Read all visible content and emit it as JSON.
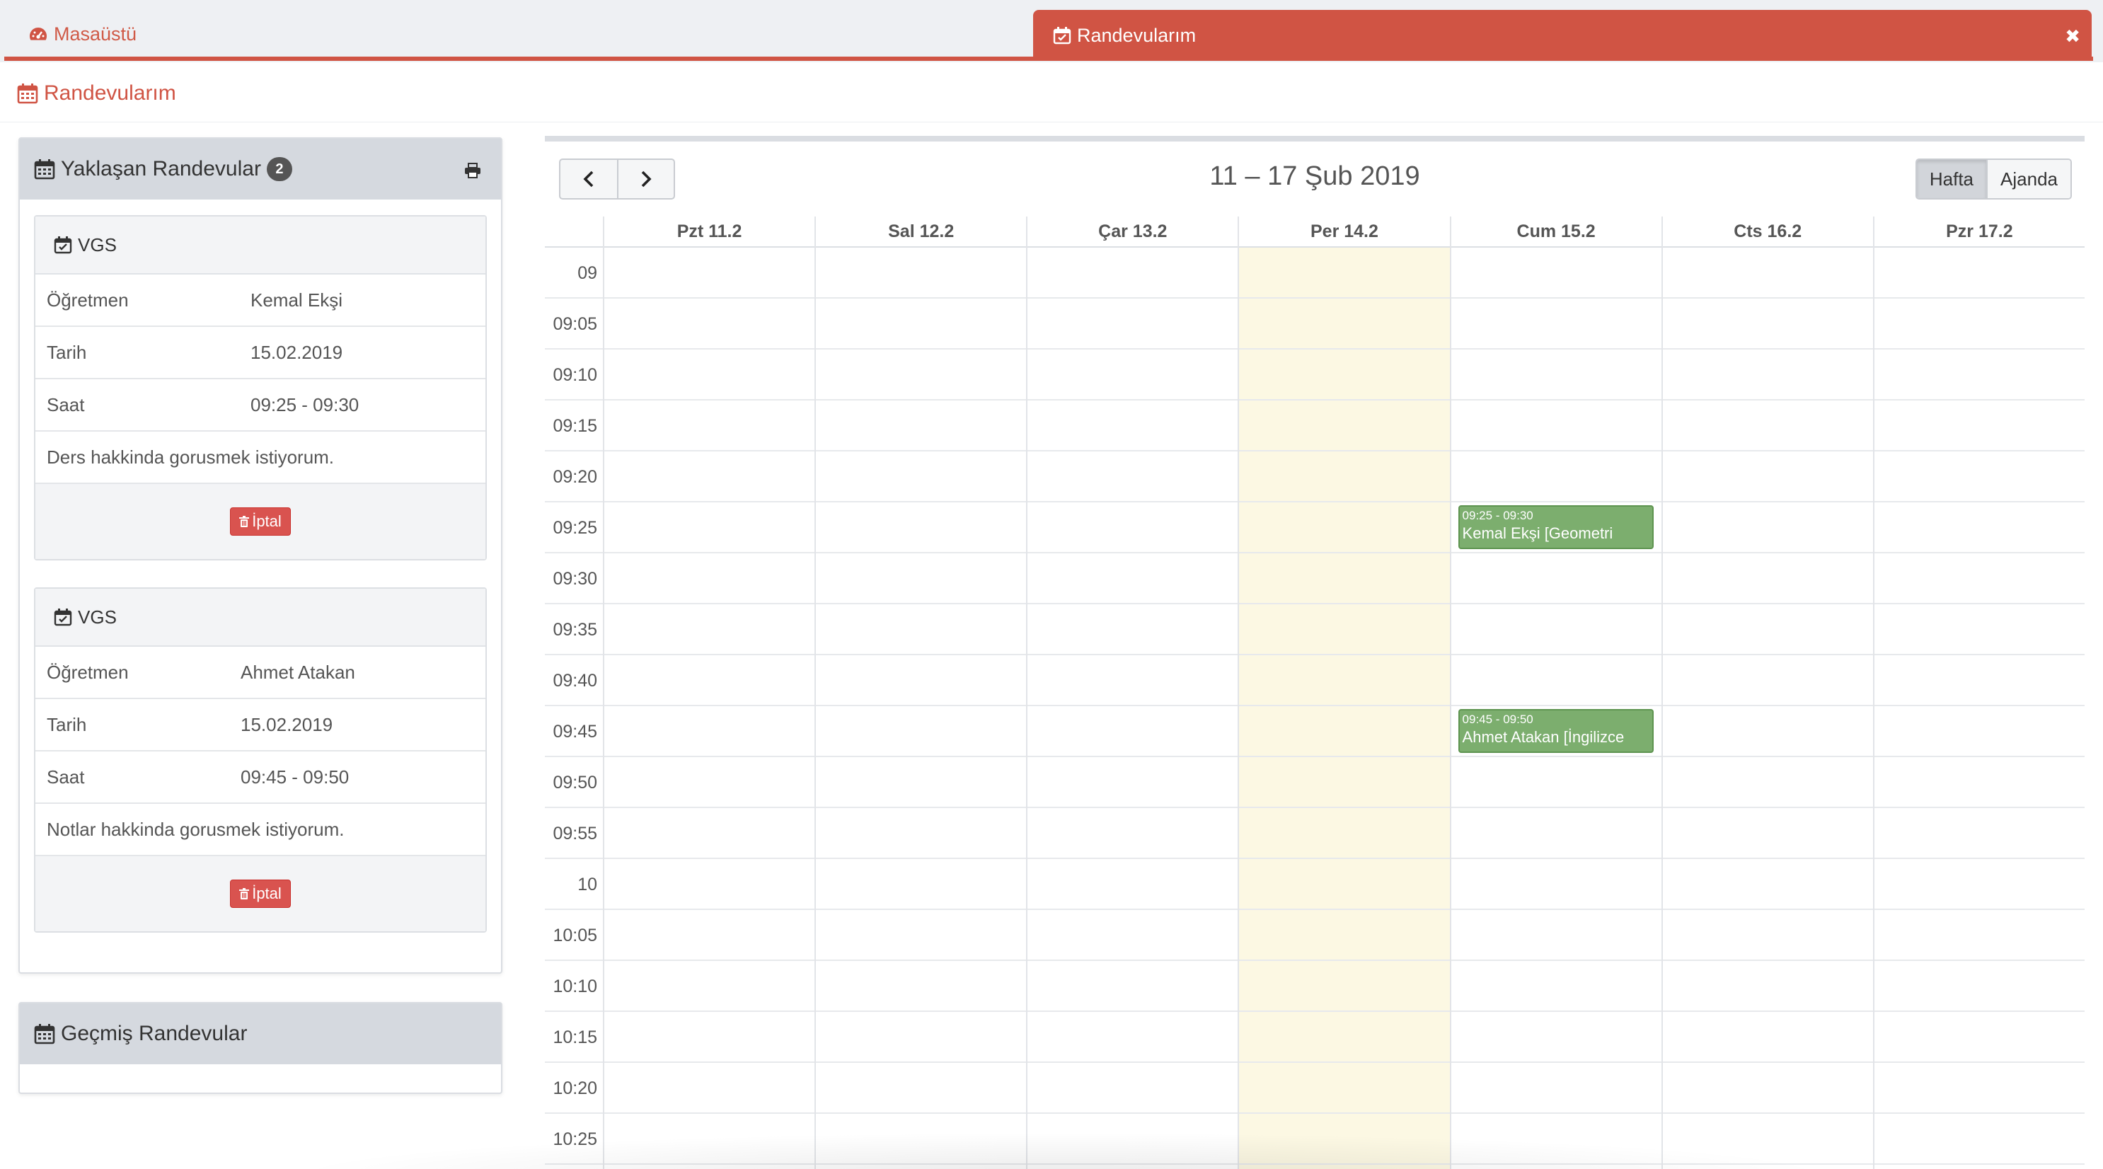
{
  "tabs": {
    "desktop_label": "Masaüstü",
    "active_label": "Randevularım",
    "close_glyph": "✖"
  },
  "page": {
    "title": "Randevularım"
  },
  "upcoming": {
    "title": "Yaklaşan Randevular",
    "count": "2",
    "cards": [
      {
        "head": "VGS",
        "rows": [
          {
            "label": "Öğretmen",
            "value": "Kemal Ekşi"
          },
          {
            "label": "Tarih",
            "value": "15.02.2019"
          },
          {
            "label": "Saat",
            "value": "09:25 - 09:30"
          }
        ],
        "note": "Ders hakkinda gorusmek istiyorum.",
        "cancel_label": "İptal"
      },
      {
        "head": "VGS",
        "rows": [
          {
            "label": "Öğretmen",
            "value": "Ahmet Atakan"
          },
          {
            "label": "Tarih",
            "value": "15.02.2019"
          },
          {
            "label": "Saat",
            "value": "09:45 - 09:50"
          }
        ],
        "note": "Notlar hakkinda gorusmek istiyorum.",
        "cancel_label": "İptal"
      }
    ]
  },
  "past": {
    "title": "Geçmiş Randevular"
  },
  "calendar": {
    "title": "11 – 17 Şub 2019",
    "views": [
      "Hafta",
      "Ajanda"
    ],
    "active_view": "Hafta",
    "days": [
      "Pzt 11.2",
      "Sal 12.2",
      "Çar 13.2",
      "Per 14.2",
      "Cum 15.2",
      "Cts 16.2",
      "Pzr 17.2"
    ],
    "today_index": 3,
    "times": [
      "09",
      "09:05",
      "09:10",
      "09:15",
      "09:20",
      "09:25",
      "09:30",
      "09:35",
      "09:40",
      "09:45",
      "09:50",
      "09:55",
      "10",
      "10:05",
      "10:10",
      "10:15",
      "10:20",
      "10:25"
    ],
    "events": [
      {
        "day_index": 4,
        "slot_index": 5,
        "time": "09:25 - 09:30",
        "title": "Kemal Ekşi [Geometri"
      },
      {
        "day_index": 4,
        "slot_index": 9,
        "time": "09:45 - 09:50",
        "title": "Ahmet Atakan [İngilizce"
      }
    ],
    "colors": {
      "event": "#7cae6e",
      "today": "#fcf8e3",
      "accent": "#d05444"
    }
  }
}
